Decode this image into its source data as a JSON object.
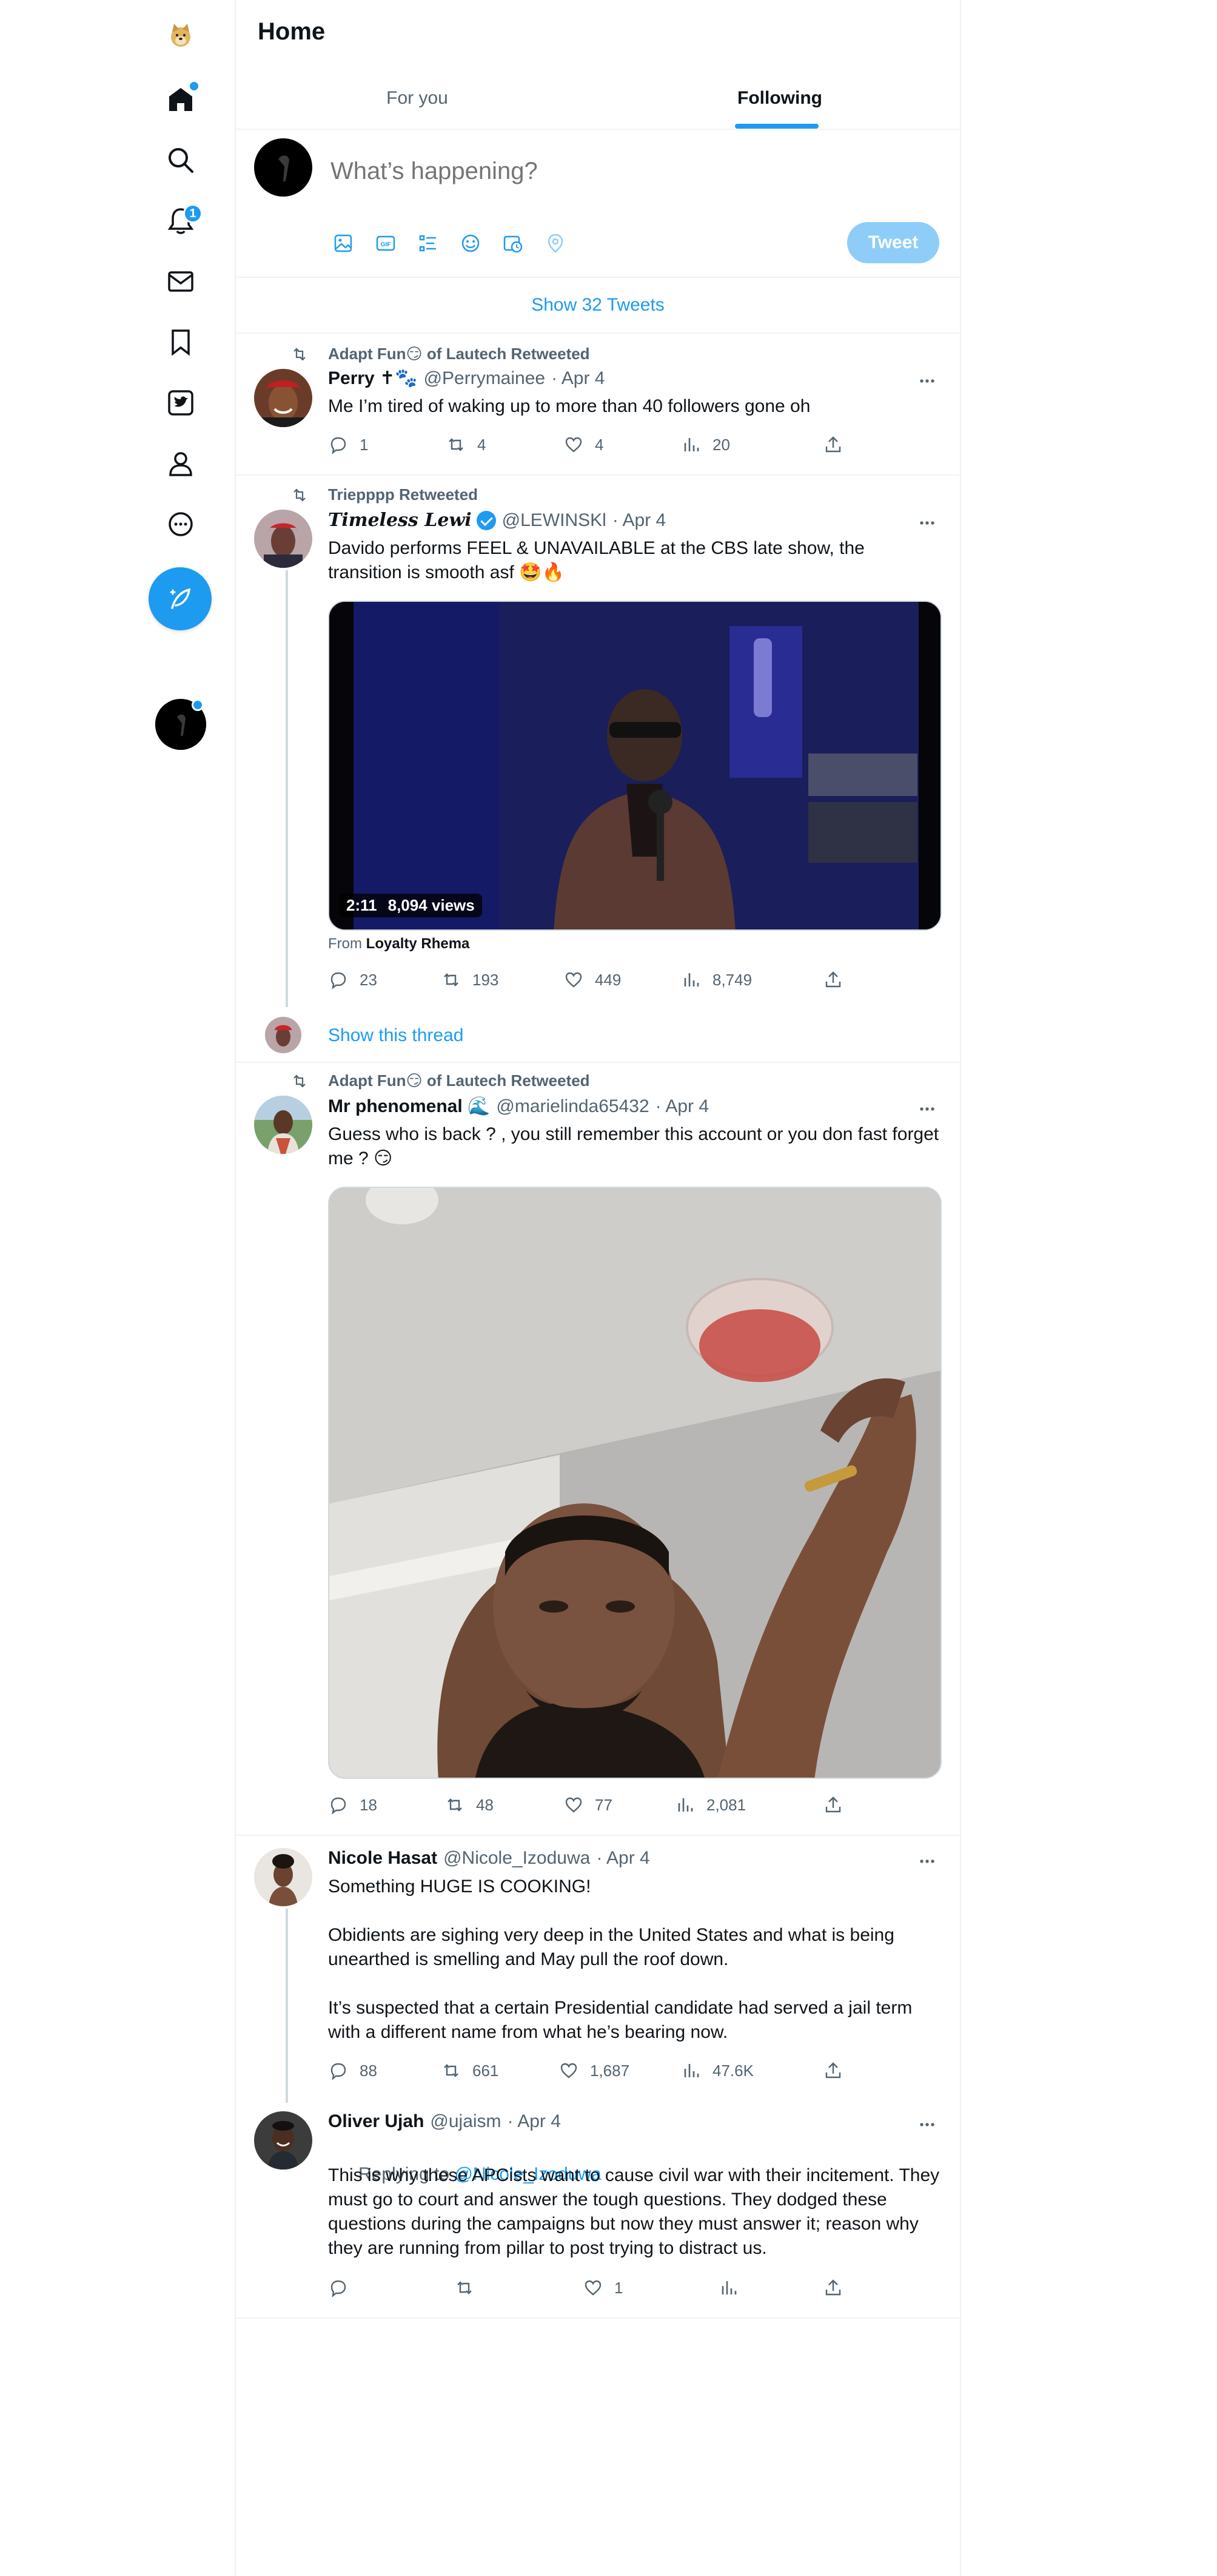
{
  "header": {
    "title": "Home"
  },
  "tabs": [
    {
      "label": "For you"
    },
    {
      "label": "Following"
    }
  ],
  "nav": {
    "notifications_badge": "1"
  },
  "composer": {
    "placeholder": "What’s happening?",
    "tweet_label": "Tweet"
  },
  "show_tweets": "Show 32 Tweets",
  "tweets": [
    {
      "retweeted_by": "Adapt Fun😏 of Lautech Retweeted",
      "name": "Perry ✝🐾",
      "handle": "@Perrymainee",
      "date": "· Apr 4",
      "text": "Me I’m tired of waking up to more than 40 followers gone oh",
      "replies": "1",
      "retweets": "4",
      "likes": "4",
      "views": "20"
    },
    {
      "retweeted_by": "Triepppp Retweeted",
      "name": "𝑻𝒊𝒎𝒆𝒍𝒆𝒔𝒔 𝑳𝒆𝒘𝒊",
      "handle": "@LEWINSKl",
      "date": "· Apr 4",
      "text": "Davido performs FEEL & UNAVAILABLE at the CBS late show, the transition is smooth asf 🤩🔥",
      "video_time": "2:11",
      "video_views": "8,094 views",
      "from_label": "From",
      "from_name": "Loyalty Rhema",
      "replies": "23",
      "retweets": "193",
      "likes": "449",
      "views": "8,749",
      "show_thread": "Show this thread"
    },
    {
      "retweeted_by": "Adapt Fun😏 of Lautech Retweeted",
      "name": "Mr phenomenal 🌊",
      "handle": "@marielinda65432",
      "date": "· Apr 4",
      "text": "Guess who is back ? , you still remember this account or you don fast forget me ? 😏",
      "replies": "18",
      "retweets": "48",
      "likes": "77",
      "views": "2,081"
    },
    {
      "name": "Nicole Hasat",
      "handle": "@Nicole_Izoduwa",
      "date": "· Apr 4",
      "text": "Something HUGE IS COOKING!\n\nObidients are sighing very deep in the United States and what is being unearthed is smelling and May pull the roof down.\n\nIt’s suspected that a certain Presidential candidate had served a jail term with a different name from what he’s bearing now.",
      "replies": "88",
      "retweets": "661",
      "likes": "1,687",
      "views": "47.6K"
    },
    {
      "name": "Oliver Ujah",
      "handle": "@ujaism",
      "date": "· Apr 4",
      "replying_label": "Replying to",
      "replying_to": "@Nicole_Izoduwa",
      "text": "This is why these APCists want to cause civil war with their incitement. They must go to court and answer the tough questions. They dodged these questions during the campaigns but now they must answer it; reason why they are running from pillar to post trying to distract us.",
      "replies": "",
      "retweets": "",
      "likes": "1",
      "views": ""
    }
  ],
  "colors": {
    "accent": "#1d9bf0",
    "text": "#0f1419",
    "muted": "#536471",
    "border": "#eff3f4"
  }
}
